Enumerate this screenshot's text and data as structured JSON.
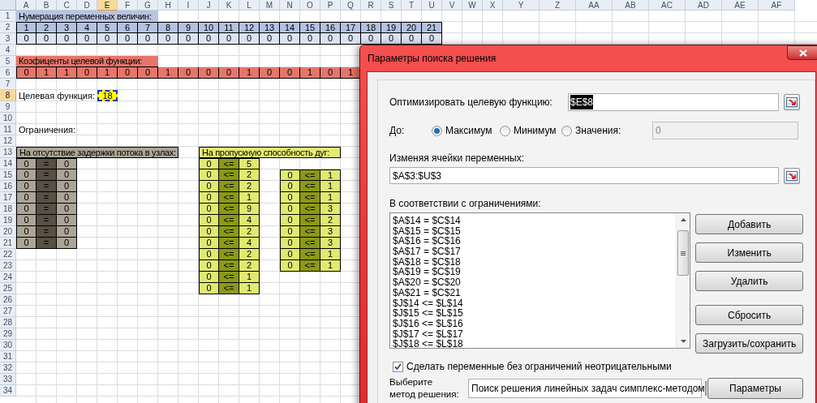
{
  "sheet": {
    "columns": [
      {
        "label": "A",
        "selected": false
      },
      {
        "label": "B",
        "selected": false
      },
      {
        "label": "C",
        "selected": false
      },
      {
        "label": "D",
        "selected": false
      },
      {
        "label": "E",
        "selected": true
      },
      {
        "label": "F",
        "selected": false
      },
      {
        "label": "G",
        "selected": false
      },
      {
        "label": "H",
        "selected": false
      },
      {
        "label": "I",
        "selected": false
      },
      {
        "label": "J",
        "selected": false
      },
      {
        "label": "K",
        "selected": false
      },
      {
        "label": "L",
        "selected": false
      },
      {
        "label": "M",
        "selected": false
      },
      {
        "label": "N",
        "selected": false
      },
      {
        "label": "O",
        "selected": false
      },
      {
        "label": "P",
        "selected": false
      },
      {
        "label": "Q",
        "selected": false
      },
      {
        "label": "R",
        "selected": false
      },
      {
        "label": "S",
        "selected": false
      },
      {
        "label": "T",
        "selected": false
      },
      {
        "label": "U",
        "selected": false
      },
      {
        "label": "V",
        "selected": false
      },
      {
        "label": "W",
        "selected": false
      },
      {
        "label": "X",
        "selected": false
      },
      {
        "label": "Y",
        "selected": false
      },
      {
        "label": "Z",
        "selected": false
      },
      {
        "label": "AA",
        "selected": false
      },
      {
        "label": "AB",
        "selected": false
      },
      {
        "label": "AC",
        "selected": false
      },
      {
        "label": "AD",
        "selected": false
      },
      {
        "label": "AE",
        "selected": false
      },
      {
        "label": "AF",
        "selected": false
      }
    ],
    "rows": [
      {
        "label": "1",
        "selected": false
      },
      {
        "label": "2",
        "selected": false
      },
      {
        "label": "3",
        "selected": false
      },
      {
        "label": "4",
        "selected": false
      },
      {
        "label": "5",
        "selected": false
      },
      {
        "label": "6",
        "selected": false
      },
      {
        "label": "7",
        "selected": false
      },
      {
        "label": "8",
        "selected": true
      },
      {
        "label": "9",
        "selected": false
      },
      {
        "label": "10",
        "selected": false
      },
      {
        "label": "11",
        "selected": false
      },
      {
        "label": "12",
        "selected": false
      },
      {
        "label": "13",
        "selected": false
      },
      {
        "label": "14",
        "selected": false
      },
      {
        "label": "15",
        "selected": false
      },
      {
        "label": "16",
        "selected": false
      },
      {
        "label": "17",
        "selected": false
      },
      {
        "label": "18",
        "selected": false
      },
      {
        "label": "19",
        "selected": false
      },
      {
        "label": "20",
        "selected": false
      },
      {
        "label": "21",
        "selected": false
      },
      {
        "label": "22",
        "selected": false
      },
      {
        "label": "23",
        "selected": false
      },
      {
        "label": "24",
        "selected": false
      },
      {
        "label": "25",
        "selected": false
      },
      {
        "label": "26",
        "selected": false
      },
      {
        "label": "27",
        "selected": false
      },
      {
        "label": "28",
        "selected": false
      },
      {
        "label": "29",
        "selected": false
      },
      {
        "label": "30",
        "selected": false
      },
      {
        "label": "31",
        "selected": false
      },
      {
        "label": "32",
        "selected": false
      },
      {
        "label": "33",
        "selected": false
      },
      {
        "label": "34",
        "selected": false
      }
    ]
  },
  "numbering": {
    "title": "Нумерация переменных величин:",
    "numbers": [
      "1",
      "2",
      "3",
      "4",
      "5",
      "6",
      "7",
      "8",
      "9",
      "10",
      "11",
      "12",
      "13",
      "14",
      "15",
      "16",
      "17",
      "18",
      "19",
      "20",
      "21"
    ],
    "values": [
      "0",
      "0",
      "0",
      "0",
      "0",
      "0",
      "0",
      "0",
      "0",
      "0",
      "0",
      "0",
      "0",
      "0",
      "0",
      "0",
      "0",
      "0",
      "0",
      "0",
      "0"
    ]
  },
  "coefficients": {
    "title": "Коэфиценты целевой функции:",
    "values": [
      "0",
      "1",
      "1",
      "0",
      "1",
      "0",
      "0",
      "1",
      "0",
      "0",
      "0",
      "1",
      "0",
      "0",
      "1",
      "0",
      "1"
    ]
  },
  "objective": {
    "label": "Целевая функция:",
    "value": "18",
    "selected": true
  },
  "constraints_title": "Ограничения:",
  "node_constraints": {
    "title": "На отсутствие задержки потока в узлах:",
    "rows": [
      [
        "0",
        "=",
        "0"
      ],
      [
        "0",
        "=",
        "0"
      ],
      [
        "0",
        "=",
        "0"
      ],
      [
        "0",
        "=",
        "0"
      ],
      [
        "0",
        "=",
        "0"
      ],
      [
        "0",
        "=",
        "0"
      ],
      [
        "0",
        "=",
        "0"
      ],
      [
        "0",
        "=",
        "0"
      ]
    ]
  },
  "arc_constraints": {
    "title": "На пропускную способность дуг:",
    "rows": [
      [
        "0",
        "<=",
        "5"
      ],
      [
        "0",
        "<=",
        "2"
      ],
      [
        "0",
        "<=",
        "2"
      ],
      [
        "0",
        "<=",
        "1"
      ],
      [
        "0",
        "<=",
        "9"
      ],
      [
        "0",
        "<=",
        "4"
      ],
      [
        "0",
        "<=",
        "2"
      ],
      [
        "0",
        "<=",
        "4"
      ],
      [
        "0",
        "<=",
        "2"
      ],
      [
        "0",
        "<=",
        "2"
      ],
      [
        "0",
        "<=",
        "1"
      ],
      [
        "0",
        "<=",
        "1"
      ]
    ],
    "rows_2": [
      [
        "0",
        "<=",
        "1"
      ],
      [
        "0",
        "<=",
        "1"
      ],
      [
        "0",
        "<=",
        "1"
      ],
      [
        "0",
        "<=",
        "3"
      ],
      [
        "0",
        "<=",
        "2"
      ],
      [
        "0",
        "<=",
        "3"
      ],
      [
        "0",
        "<=",
        "3"
      ],
      [
        "0",
        "<=",
        "1"
      ],
      [
        "0",
        "<=",
        "1"
      ]
    ]
  },
  "dialog": {
    "title": "Параметры поиска решения",
    "objective_label": "Оптимизировать целевую функцию:",
    "objective_field": {
      "value": "$E$8",
      "selected": true
    },
    "to_label": "До:",
    "options": [
      {
        "label": "Максимум",
        "selected": true
      },
      {
        "label": "Минимум",
        "selected": false
      },
      {
        "label": "Значения:",
        "selected": false
      }
    ],
    "value_field": {
      "value": "0",
      "disabled": true
    },
    "variables_label": "Изменяя ячейки переменных:",
    "variables_field": "$A$3:$U$3",
    "constraints_label": "В соответствии с ограничениями:",
    "constraints": [
      "$A$14 = $C$14",
      "$A$15 = $C$15",
      "$A$16 = $C$16",
      "$A$17 = $C$17",
      "$A$18 = $C$18",
      "$A$19 = $C$19",
      "$A$20 = $C$20",
      "$A$21 = $C$21",
      "$J$14 <= $L$14",
      "$J$15 <= $L$15",
      "$J$16 <= $L$16",
      "$J$17 <= $L$17",
      "$J$18 <= $L$18"
    ],
    "buttons": [
      "Добавить",
      "Изменить",
      "Удалить",
      "Сбросить",
      "Загрузить/сохранить"
    ],
    "nonnegative": {
      "label": "Сделать переменные без ограничений неотрицательными",
      "checked": true
    },
    "method_label": "Выберите метод решения:",
    "method": "Поиск решения линейных задач симплекс-методом",
    "options_button": "Параметры"
  }
}
